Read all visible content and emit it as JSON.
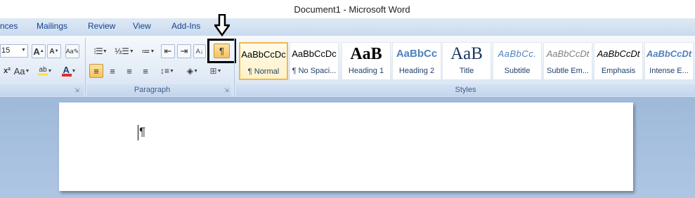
{
  "window": {
    "title": "Document1 - Microsoft Word"
  },
  "tabs": [
    "nces",
    "Mailings",
    "Review",
    "View",
    "Add-Ins"
  ],
  "font_group": {
    "font_size": "15",
    "grow_font_glyph": "A",
    "shrink_font_glyph": "A",
    "change_case_glyph": "Aa",
    "font_color_glyph": "A"
  },
  "paragraph_group": {
    "label": "Paragraph",
    "show_hide_glyph": "¶"
  },
  "styles_group": {
    "label": "Styles",
    "items": [
      {
        "sample": "AaBbCcDc",
        "name": "¶ Normal",
        "selected": true
      },
      {
        "sample": "AaBbCcDc",
        "name": "¶ No Spaci..."
      },
      {
        "sample": "AaB",
        "name": "Heading 1"
      },
      {
        "sample": "AaBbCc",
        "name": "Heading 2"
      },
      {
        "sample": "AaB",
        "name": "Title"
      },
      {
        "sample": "AaBbCc.",
        "name": "Subtitle"
      },
      {
        "sample": "AaBbCcDt",
        "name": "Subtle Em..."
      },
      {
        "sample": "AaBbCcDt",
        "name": "Emphasis"
      },
      {
        "sample": "AaBbCcDt",
        "name": "Intense E..."
      }
    ]
  },
  "document": {
    "paragraph_mark": "¶"
  },
  "colors": {
    "highlight": "#ffe44d",
    "font_color": "#e12d2d",
    "active_button": "#f8c25c",
    "annotation": "#000000"
  }
}
